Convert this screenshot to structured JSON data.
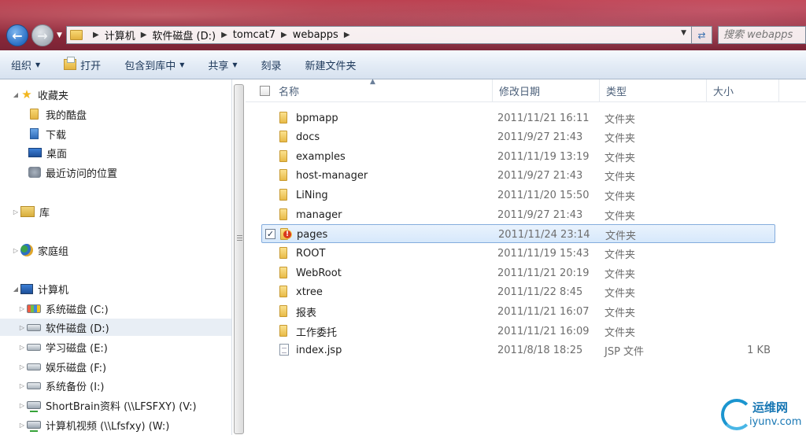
{
  "address": {
    "crumbs": [
      "计算机",
      "软件磁盘 (D:)",
      "tomcat7",
      "webapps"
    ]
  },
  "search": {
    "placeholder": "搜索 webapps"
  },
  "toolbar": {
    "organize": "组织",
    "open": "打开",
    "include_library": "包含到库中",
    "share": "共享",
    "burn": "刻录",
    "new_folder": "新建文件夹"
  },
  "nav": {
    "favorites": "收藏夹",
    "kudisk": "我的酷盘",
    "downloads": "下载",
    "desktop": "桌面",
    "recent": "最近访问的位置",
    "libraries": "库",
    "homegroup": "家庭组",
    "computer": "计算机",
    "drives": [
      "系统磁盘 (C:)",
      "软件磁盘 (D:)",
      "学习磁盘 (E:)",
      "娱乐磁盘 (F:)",
      "系统备份 (I:)",
      "ShortBrain资料 (\\\\LFSFXY) (V:)",
      "计算机视频 (\\\\Lfsfxy) (W:)"
    ]
  },
  "columns": {
    "name": "名称",
    "date": "修改日期",
    "type": "类型",
    "size": "大小"
  },
  "files": [
    {
      "name": "bpmapp",
      "date": "2011/11/21 16:11",
      "type": "文件夹",
      "size": ""
    },
    {
      "name": "docs",
      "date": "2011/9/27 21:43",
      "type": "文件夹",
      "size": ""
    },
    {
      "name": "examples",
      "date": "2011/11/19 13:19",
      "type": "文件夹",
      "size": ""
    },
    {
      "name": "host-manager",
      "date": "2011/9/27 21:43",
      "type": "文件夹",
      "size": ""
    },
    {
      "name": "LiNing",
      "date": "2011/11/20 15:50",
      "type": "文件夹",
      "size": ""
    },
    {
      "name": "manager",
      "date": "2011/9/27 21:43",
      "type": "文件夹",
      "size": ""
    },
    {
      "name": "pages",
      "date": "2011/11/24 23:14",
      "type": "文件夹",
      "size": ""
    },
    {
      "name": "ROOT",
      "date": "2011/11/19 15:43",
      "type": "文件夹",
      "size": ""
    },
    {
      "name": "WebRoot",
      "date": "2011/11/21 20:19",
      "type": "文件夹",
      "size": ""
    },
    {
      "name": "xtree",
      "date": "2011/11/22 8:45",
      "type": "文件夹",
      "size": ""
    },
    {
      "name": "报表",
      "date": "2011/11/21 16:07",
      "type": "文件夹",
      "size": ""
    },
    {
      "name": "工作委托",
      "date": "2011/11/21 16:09",
      "type": "文件夹",
      "size": ""
    },
    {
      "name": "index.jsp",
      "date": "2011/8/18 18:25",
      "type": "JSP 文件",
      "size": "1 KB"
    }
  ],
  "watermark": {
    "cn": "运维网",
    "en": "iyunv.com"
  }
}
